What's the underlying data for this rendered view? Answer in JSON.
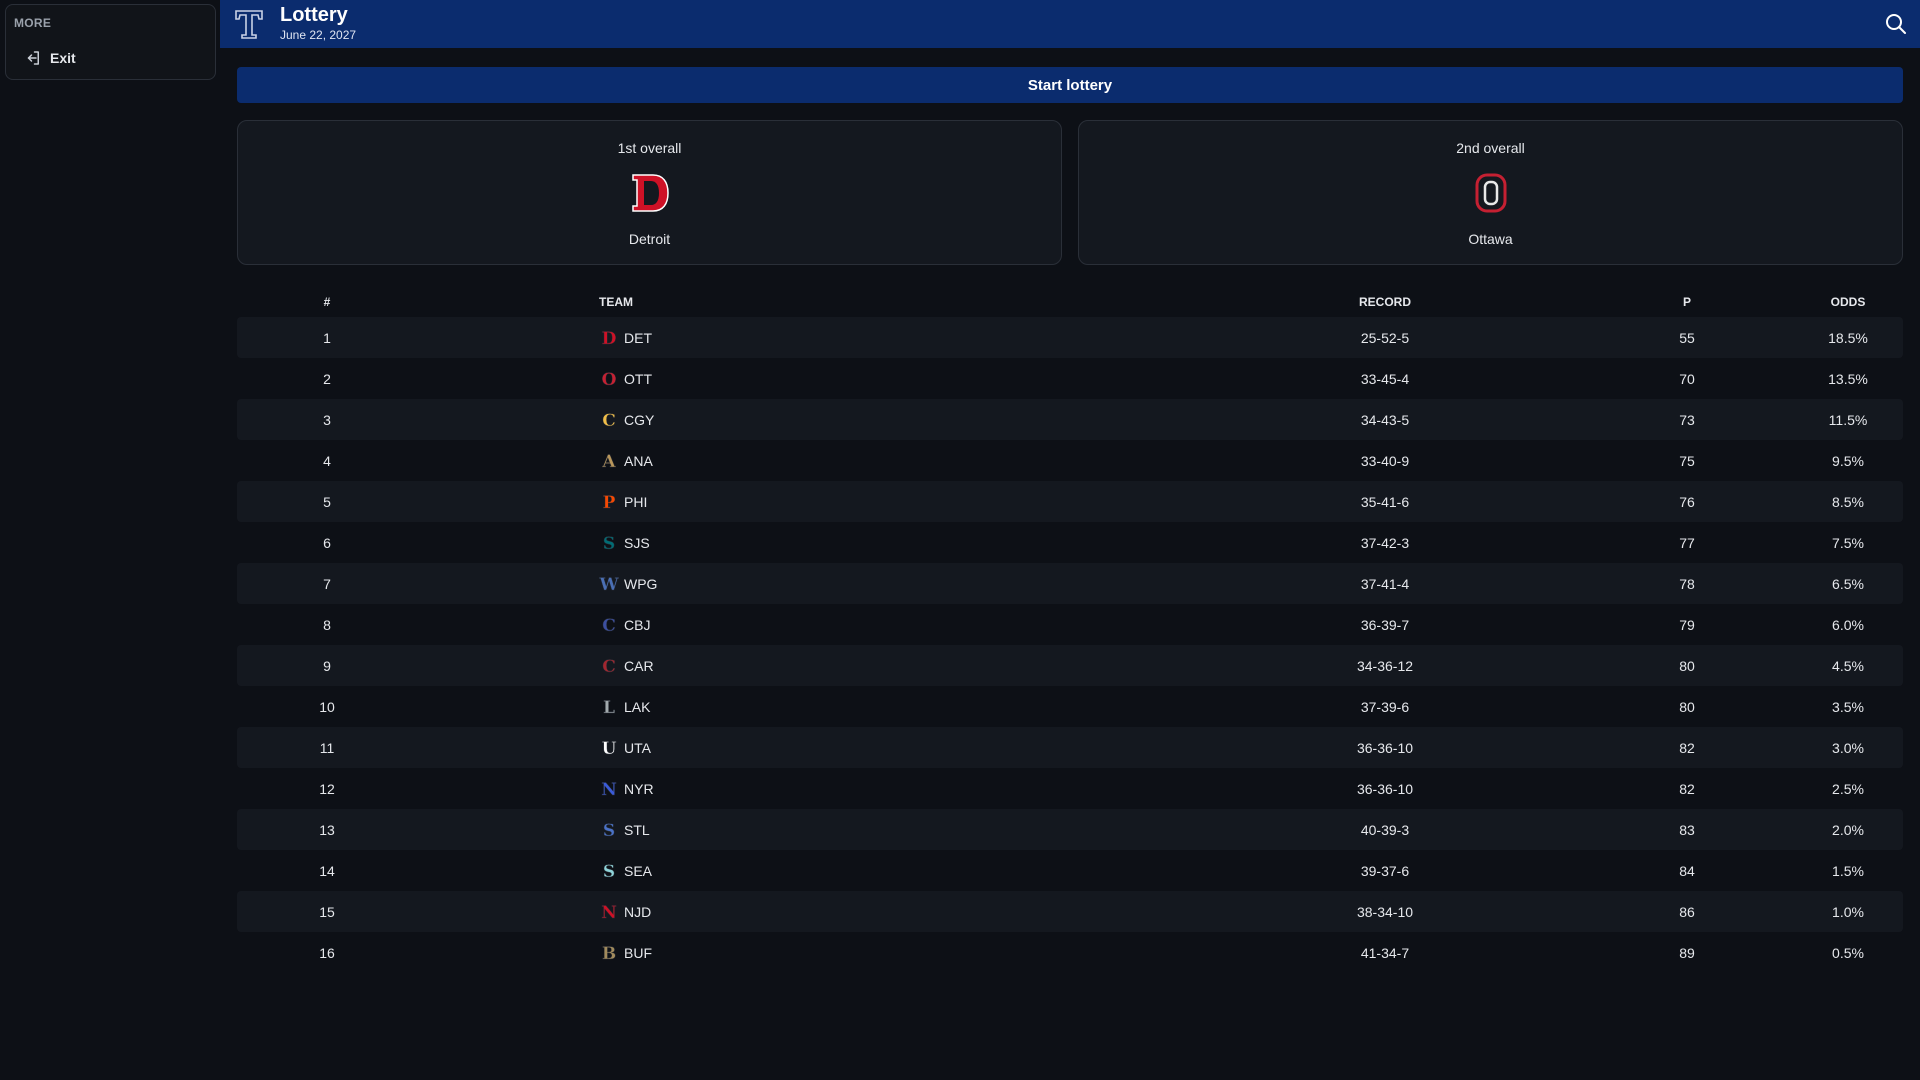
{
  "sidebar": {
    "more_title": "MORE",
    "exit_label": "Exit"
  },
  "header": {
    "title": "Lottery",
    "date": "June 22, 2027"
  },
  "actions": {
    "start_label": "Start lottery"
  },
  "picks": [
    {
      "label": "1st overall",
      "team": "Detroit",
      "letter": "D",
      "color": "#ce1126"
    },
    {
      "label": "2nd overall",
      "team": "Ottawa",
      "letter": "O",
      "color": "#c52032"
    }
  ],
  "table": {
    "headers": {
      "num": "#",
      "team": "TEAM",
      "record": "RECORD",
      "points": "P",
      "odds": "ODDS"
    },
    "rows": [
      {
        "num": "1",
        "team": "DET",
        "record": "25-52-5",
        "points": "55",
        "odds": "18.5%",
        "letter": "D",
        "color": "#ce1126"
      },
      {
        "num": "2",
        "team": "OTT",
        "record": "33-45-4",
        "points": "70",
        "odds": "13.5%",
        "letter": "O",
        "color": "#c52032"
      },
      {
        "num": "3",
        "team": "CGY",
        "record": "34-43-5",
        "points": "73",
        "odds": "11.5%",
        "letter": "C",
        "color": "#f1be48"
      },
      {
        "num": "4",
        "team": "ANA",
        "record": "33-40-9",
        "points": "75",
        "odds": "9.5%",
        "letter": "A",
        "color": "#b9975b"
      },
      {
        "num": "5",
        "team": "PHI",
        "record": "35-41-6",
        "points": "76",
        "odds": "8.5%",
        "letter": "P",
        "color": "#f74902"
      },
      {
        "num": "6",
        "team": "SJS",
        "record": "37-42-3",
        "points": "77",
        "odds": "7.5%",
        "letter": "S",
        "color": "#006d75"
      },
      {
        "num": "7",
        "team": "WPG",
        "record": "37-41-4",
        "points": "78",
        "odds": "6.5%",
        "letter": "W",
        "color": "#4a6fb5"
      },
      {
        "num": "8",
        "team": "CBJ",
        "record": "36-39-7",
        "points": "79",
        "odds": "6.0%",
        "letter": "C",
        "color": "#3c4fa0"
      },
      {
        "num": "9",
        "team": "CAR",
        "record": "34-36-12",
        "points": "80",
        "odds": "4.5%",
        "letter": "C",
        "color": "#a3262f"
      },
      {
        "num": "10",
        "team": "LAK",
        "record": "37-39-6",
        "points": "80",
        "odds": "3.5%",
        "letter": "L",
        "color": "#a2aaad"
      },
      {
        "num": "11",
        "team": "UTA",
        "record": "36-36-10",
        "points": "82",
        "odds": "3.0%",
        "letter": "U",
        "color": "#ffffff"
      },
      {
        "num": "12",
        "team": "NYR",
        "record": "36-36-10",
        "points": "82",
        "odds": "2.5%",
        "letter": "N",
        "color": "#3a5bd9"
      },
      {
        "num": "13",
        "team": "STL",
        "record": "40-39-3",
        "points": "83",
        "odds": "2.0%",
        "letter": "S",
        "color": "#4a72c8"
      },
      {
        "num": "14",
        "team": "SEA",
        "record": "39-37-6",
        "points": "84",
        "odds": "1.5%",
        "letter": "S",
        "color": "#8fd4d9"
      },
      {
        "num": "15",
        "team": "NJD",
        "record": "38-34-10",
        "points": "86",
        "odds": "1.0%",
        "letter": "N",
        "color": "#ce1126"
      },
      {
        "num": "16",
        "team": "BUF",
        "record": "41-34-7",
        "points": "89",
        "odds": "0.5%",
        "letter": "B",
        "color": "#a28b5c"
      }
    ]
  },
  "icons": {
    "logo": "t-logo-icon",
    "search": "search-icon",
    "exit": "exit-icon"
  }
}
